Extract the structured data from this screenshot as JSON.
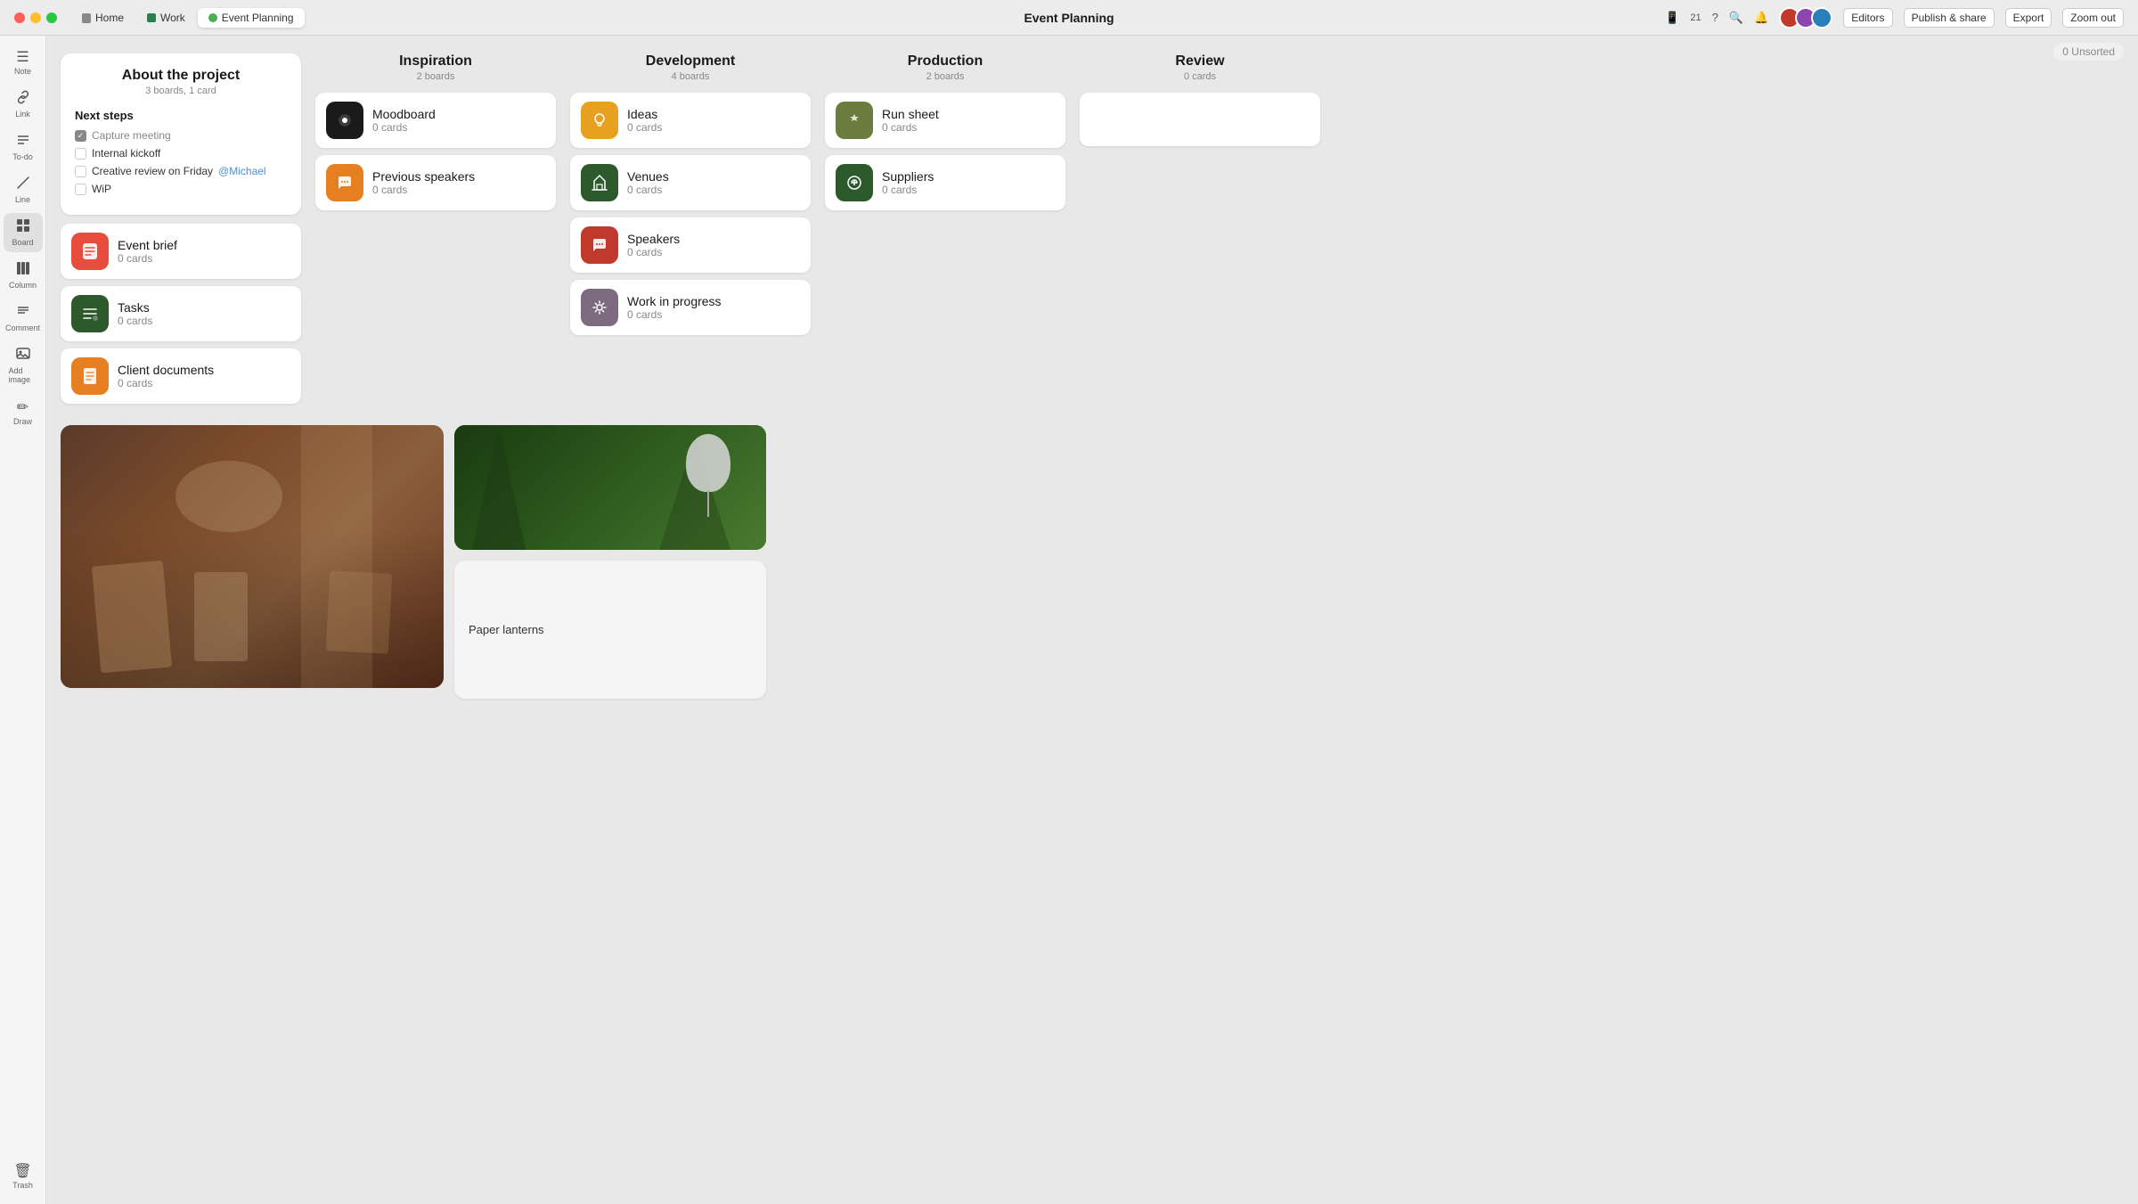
{
  "titlebar": {
    "title": "Event Planning",
    "tabs": [
      {
        "label": "Home",
        "type": "home",
        "active": false
      },
      {
        "label": "Work",
        "type": "work",
        "active": false
      },
      {
        "label": "Event Planning",
        "type": "event",
        "active": true
      }
    ],
    "notification_count": "21",
    "buttons": {
      "editors": "Editors",
      "publish_share": "Publish & share",
      "export": "Export",
      "zoom_out": "Zoom out"
    }
  },
  "sidebar": {
    "items": [
      {
        "id": "note",
        "label": "Note",
        "icon": "☰"
      },
      {
        "id": "link",
        "label": "Link",
        "icon": "🔗"
      },
      {
        "id": "todo",
        "label": "To-do",
        "icon": "≡"
      },
      {
        "id": "line",
        "label": "Line",
        "icon": "/"
      },
      {
        "id": "board",
        "label": "Board",
        "icon": "⊞",
        "active": true
      },
      {
        "id": "column",
        "label": "Column",
        "icon": "||"
      },
      {
        "id": "comment",
        "label": "Comment",
        "icon": "≡"
      },
      {
        "id": "add-image",
        "label": "Add image",
        "icon": "🖼"
      },
      {
        "id": "draw",
        "label": "Draw",
        "icon": "✏"
      }
    ],
    "trash_label": "Trash"
  },
  "unsorted": "0 Unsorted",
  "about": {
    "title": "About the project",
    "subtitle": "3 boards, 1 card",
    "next_steps_title": "Next steps",
    "checklist": [
      {
        "text": "Capture meeting",
        "done": true
      },
      {
        "text": "Internal kickoff",
        "done": false
      },
      {
        "text": "Creative review on Friday",
        "done": false,
        "mention": "@Michael"
      },
      {
        "text": "WiP",
        "done": false
      }
    ],
    "boards": [
      {
        "name": "Event brief",
        "cards": "0 cards",
        "icon": "📋",
        "color": "icon-red"
      },
      {
        "name": "Tasks",
        "cards": "0 cards",
        "icon": "📝",
        "color": "icon-green-dark"
      },
      {
        "name": "Client documents",
        "cards": "0 cards",
        "icon": "📄",
        "color": "icon-orange"
      }
    ]
  },
  "columns": [
    {
      "id": "inspiration",
      "title": "Inspiration",
      "subtitle": "2 boards",
      "cards": [
        {
          "name": "Moodboard",
          "cards": "0 cards",
          "icon_color": "black",
          "icon": "⬤"
        },
        {
          "name": "Previous speakers",
          "cards": "0 cards",
          "icon_color": "orange",
          "icon": "💬"
        }
      ]
    },
    {
      "id": "development",
      "title": "Development",
      "subtitle": "4 boards",
      "cards": [
        {
          "name": "Ideas",
          "cards": "0 cards",
          "icon_color": "amber",
          "icon": "💡"
        },
        {
          "name": "Venues",
          "cards": "0 cards",
          "icon_color": "dark-green",
          "icon": "🏛"
        },
        {
          "name": "Speakers",
          "cards": "0 cards",
          "icon_color": "pink-red",
          "icon": "💬"
        },
        {
          "name": "Work in progress",
          "cards": "0 cards",
          "icon_color": "purple-gray",
          "icon": "🔄"
        }
      ]
    },
    {
      "id": "production",
      "title": "Production",
      "subtitle": "2 boards",
      "cards": [
        {
          "name": "Run sheet",
          "cards": "0 cards",
          "icon_color": "olive",
          "icon": "📍"
        },
        {
          "name": "Suppliers",
          "cards": "0 cards",
          "icon_color": "dark-green",
          "icon": "⚙"
        }
      ]
    },
    {
      "id": "review",
      "title": "Review",
      "subtitle": "0 cards",
      "cards": []
    }
  ],
  "image_section": {
    "paper_lantern_label": "Paper lanterns"
  }
}
